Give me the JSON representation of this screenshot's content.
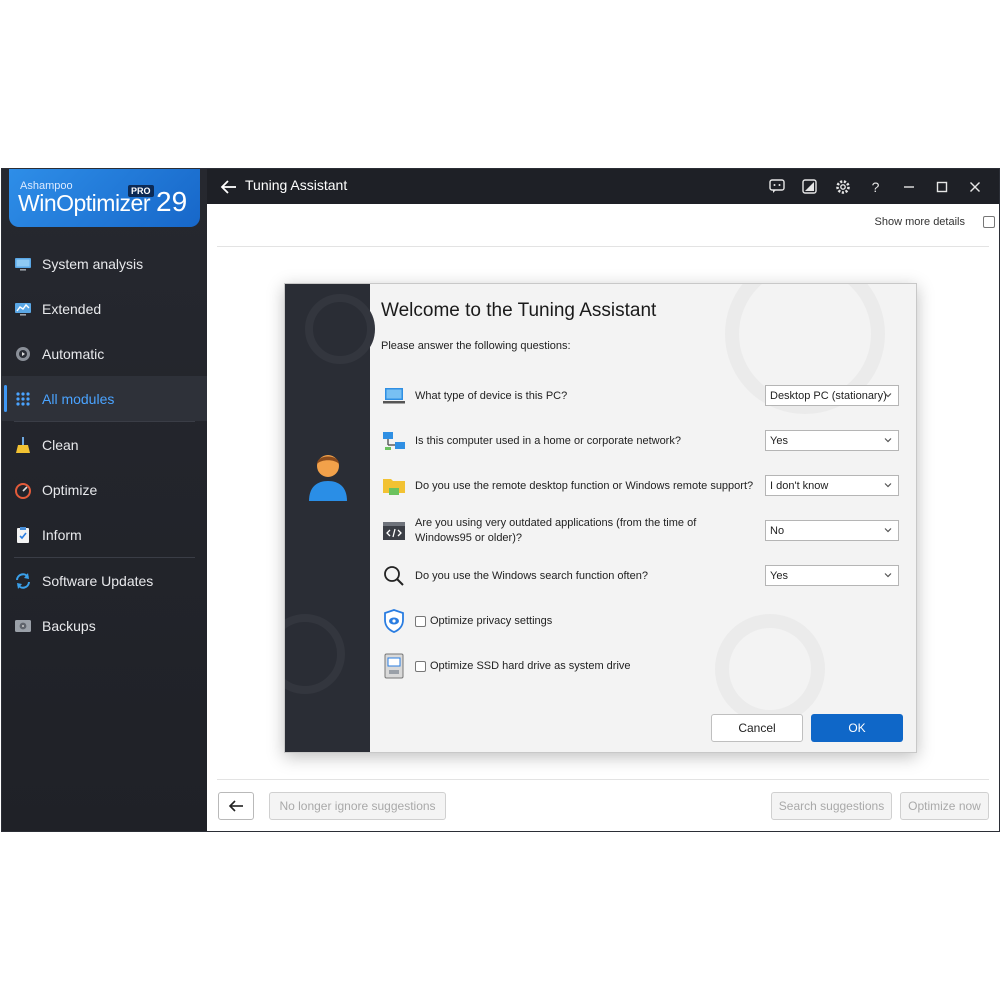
{
  "app": {
    "brand": "Ashampoo",
    "product": "WinOptimizer",
    "badge": "PRO",
    "version": "29",
    "title": "Tuning Assistant"
  },
  "sidebar": {
    "items": [
      {
        "label": "System analysis",
        "icon": "monitor-icon"
      },
      {
        "label": "Extended",
        "icon": "chart-monitor-icon"
      },
      {
        "label": "Automatic",
        "icon": "gear-play-icon"
      },
      {
        "label": "All modules",
        "icon": "grid-dots-icon",
        "active": true
      },
      {
        "label": "Clean",
        "icon": "broom-icon"
      },
      {
        "label": "Optimize",
        "icon": "speedometer-icon"
      },
      {
        "label": "Inform",
        "icon": "clipboard-check-icon"
      },
      {
        "label": "Software Updates",
        "icon": "refresh-icon"
      },
      {
        "label": "Backups",
        "icon": "drive-icon"
      }
    ]
  },
  "header": {
    "show_details_label": "Show more details"
  },
  "footer": {
    "ignore_label": "No longer ignore suggestions",
    "search_label": "Search suggestions",
    "optimize_label": "Optimize now"
  },
  "dialog": {
    "title": "Welcome to the Tuning Assistant",
    "subtitle": "Please answer the following questions:",
    "questions": [
      {
        "text": "What type of device is this PC?",
        "value": "Desktop PC (stationary)",
        "icon": "laptop-icon"
      },
      {
        "text": "Is this computer used in a home or corporate network?",
        "value": "Yes",
        "icon": "network-icon"
      },
      {
        "text": "Do you use the remote desktop function or Windows remote support?",
        "value": "I don't know",
        "icon": "folder-remote-icon"
      },
      {
        "text": "Are you using very outdated applications (from the time of Windows95 or older)?",
        "value": "No",
        "icon": "code-window-icon"
      },
      {
        "text": "Do you use the Windows search function often?",
        "value": "Yes",
        "icon": "search-icon"
      }
    ],
    "checks": [
      {
        "text": "Optimize privacy settings",
        "checked": false,
        "icon": "privacy-shield-icon"
      },
      {
        "text": "Optimize SSD hard drive as system drive",
        "checked": false,
        "icon": "ssd-icon"
      }
    ],
    "cancel_label": "Cancel",
    "ok_label": "OK"
  },
  "colors": {
    "accent": "#0f67c8",
    "sidebar_bg": "#26282f",
    "active_nav": "#4aa3ff",
    "titlebar_bg": "#1e2026"
  }
}
